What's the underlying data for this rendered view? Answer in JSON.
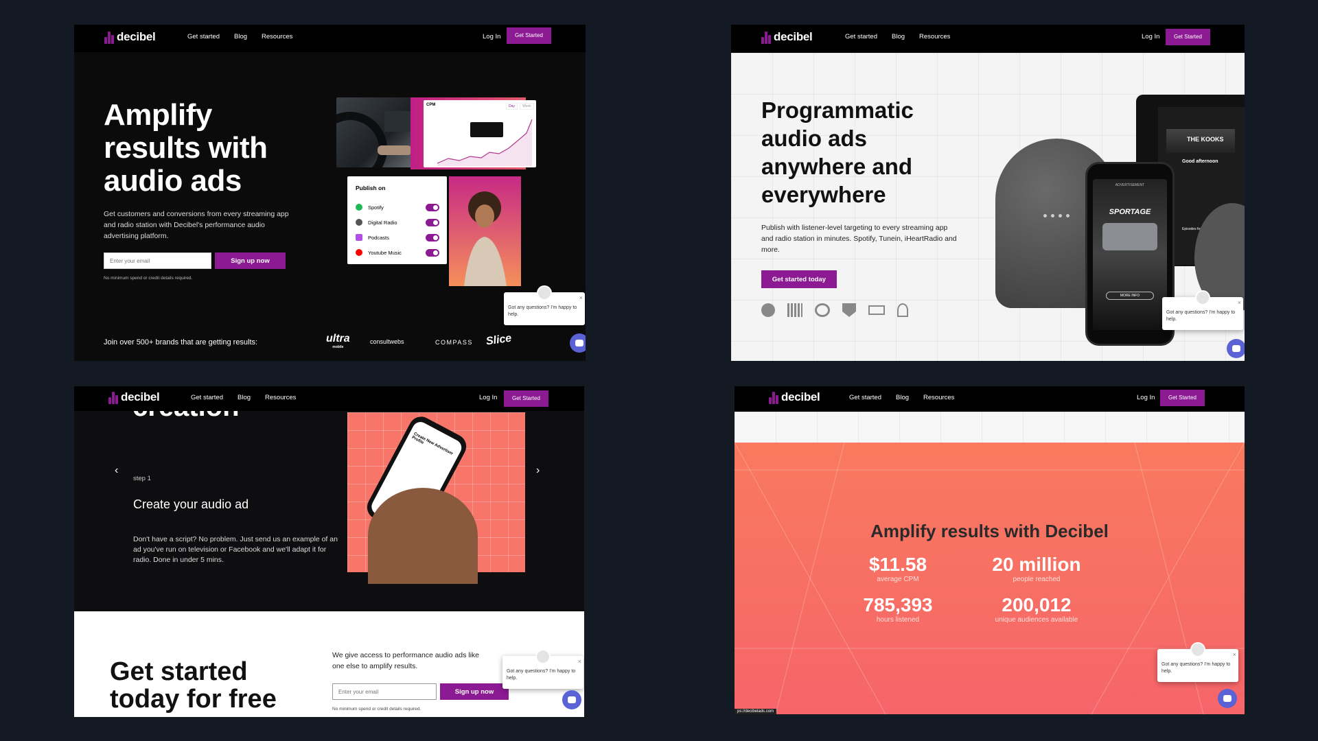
{
  "nav": {
    "logo": "decibel",
    "links": [
      "Get started",
      "Blog",
      "Resources"
    ],
    "login": "Log In",
    "cta": "Get Started"
  },
  "panel1": {
    "headline": [
      "Amplify",
      "results with",
      "audio ads"
    ],
    "subtext": "Get customers and conversions from every streaming app and radio station with Decibel's performance audio advertising platform.",
    "email_placeholder": "Enter your email",
    "signup": "Sign up now",
    "note": "No minimum spend or credit details required.",
    "chart_label": "CPM",
    "chart_tabs": [
      "Day",
      "Week"
    ],
    "publish_title": "Publish on",
    "channels": [
      "Spotify",
      "Digital Radio",
      "Podcasts",
      "Youtube Music"
    ],
    "brands_text": "Join over 500+ brands that are getting results:",
    "brands": [
      "ultra",
      "consultwebs",
      "COMPASS",
      "Slice"
    ],
    "ultra_sub": "mobile"
  },
  "panel2": {
    "headline": [
      "Programmatic",
      "audio ads",
      "anywhere and",
      "everywhere"
    ],
    "subtext": "Publish with listener-level targeting to every streaming app and radio station in minutes. Spotify, Tunein, iHeartRadio and more.",
    "cta": "Get started today",
    "phone_ad_label": "ADVERTISEMENT",
    "phone_car": "SPORTAGE",
    "phone_more": "MORE INFO",
    "screen_band": "THE KOOKS",
    "screen_greeting": "Good afternoon",
    "screen_episodes": "Episodes for you"
  },
  "panel3": {
    "partial_heading": "creation",
    "step_label": "step 1",
    "step_title": "Create your audio ad",
    "step_body": "Don't have a script? No problem. Just send us an example of an ad you've run on television or Facebook and we'll adapt it for radio. Done in under 5 mins.",
    "cta_heading": [
      "Get started",
      "today for free"
    ],
    "cta_body": "We give access to performance audio ads like one else to amplify results.",
    "email_placeholder": "Enter your email",
    "signup": "Sign up now",
    "note": "No minimum spend or credit details required.",
    "phone_title": "Create New Advertiser Profile"
  },
  "panel4": {
    "heading": "Amplify results with Decibel",
    "stats": [
      {
        "value": "$11.58",
        "label": "average CPM"
      },
      {
        "value": "20 million",
        "label": "people reached"
      },
      {
        "value": "785,393",
        "label": "hours listened"
      },
      {
        "value": "200,012",
        "label": "unique audiences available"
      }
    ],
    "url": "ps://decibelads.com"
  },
  "chat": {
    "text": "Got any questions? I'm happy to help."
  },
  "colors": {
    "brand": "#8b1a93",
    "bg": "#141a24",
    "coral": "#f76d62",
    "chat": "#5b62d6"
  }
}
